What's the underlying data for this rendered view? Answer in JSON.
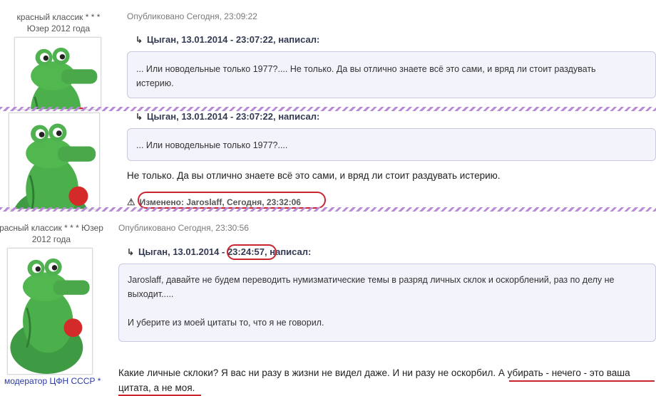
{
  "posts": [
    {
      "rank": "красный классик * * *",
      "rank2": "Юзер 2012 года",
      "published": "Опубликовано Сегодня, 23:09:22",
      "quote_header": "Цыган, 13.01.2014 - 23:07:22, написал:",
      "quote_lines": [
        "... Или новодельные только 1977?.... Не только. Да вы отлично знаете всё это сами, и вряд ли стоит раздувать",
        "истерию."
      ]
    },
    {
      "quote_header": "Цыган, 13.01.2014 - 23:07:22, написал:",
      "quote_text": "... Или новодельные только 1977?....",
      "body_text": "Не только. Да вы отлично знаете всё это сами, и вряд ли стоит раздувать истерию.",
      "edited": "Изменено: Jaroslaff, Сегодня, 23:32:06"
    },
    {
      "rank": "расный классик * * * Юзер",
      "rank2": "2012 года",
      "published": "Опубликовано Сегодня, 23:30:56",
      "quote_header_author": "Цыган, 13.01.2014 -",
      "quote_header_time": "23:24:57,",
      "quote_header_suffix": "написал:",
      "quote_lines": [
        "Jaroslaff, давайте не будем переводить нумизматические темы в разряд личных склок и оскорблений, раз по делу не",
        "выходит.....",
        "",
        "И уберите из моей цитаты то, что я не говорил."
      ],
      "moderator": "модератор ЦФН СССР *",
      "body_line1": "Какие личные склоки? Я вас ни разу в жизни не видел даже. И ни разу не оскорбил. А убирать - нечего - это ваша",
      "body_line2": "цитата, а не моя."
    }
  ],
  "icons": {
    "quote": "quote-arrow-icon",
    "warning": "warning-icon",
    "avatar": "crocodile-avatar"
  },
  "colors": {
    "divider": "#b98bd6",
    "highlight": "#c8252f",
    "quote_bg": "#f3f3fb",
    "moderator": "#2a3aa8"
  }
}
